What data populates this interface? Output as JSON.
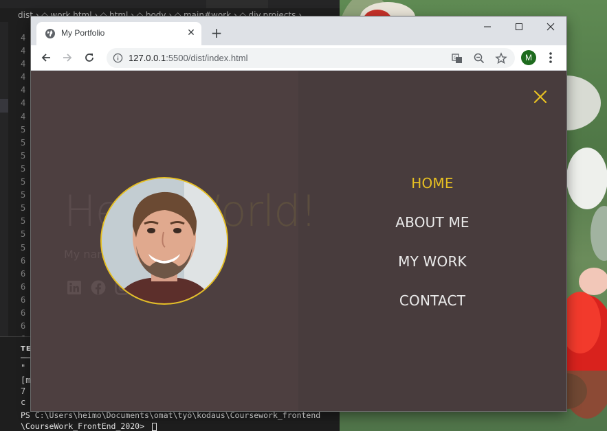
{
  "vscode": {
    "breadcrumb": "dist ›  ◇ work.html ›  ◇ html ›  ◇ body ›  ◇ main#work ›  ◇ div.projects ›",
    "line_numbers": [
      "4",
      "4",
      "4",
      "4",
      "4",
      "4",
      "4",
      "5",
      "5",
      "5",
      "5",
      "5",
      "5",
      "5",
      "5",
      "5",
      "5",
      "6",
      "6",
      "6",
      "6",
      "6",
      "6",
      "6"
    ],
    "panel_tab": "TER",
    "panel_lines": [
      "\"",
      "[m",
      " 7",
      " c"
    ],
    "terminal_line1": "PS C:\\Users\\heimo\\Documents\\omat\\työ\\kodaus\\Coursework_frontend",
    "terminal_line2": "\\CourseWork_FrontEnd_2020> "
  },
  "browser": {
    "tab_title": "My Portfolio",
    "tab_close": "✕",
    "new_tab": "+",
    "url_host": "127.0.0.1",
    "url_rest": ":5500/dist/index.html",
    "profile_initial": "M"
  },
  "page": {
    "hero_title_start": "Hello ",
    "hero_title_accent": "World!",
    "hero_subtitle": "My name is Mike",
    "nav": [
      {
        "label": "HOME",
        "active": true
      },
      {
        "label": "ABOUT ME",
        "active": false
      },
      {
        "label": "MY WORK",
        "active": false
      },
      {
        "label": "CONTACT",
        "active": false
      }
    ],
    "social_icons": [
      "linkedin-icon",
      "facebook-icon",
      "instagram-icon",
      "github-icon"
    ],
    "colors": {
      "accent": "#e7c022",
      "overlay_left": "#4d3f40",
      "overlay_right": "#483c3d",
      "nav_text": "#ebebeb"
    }
  }
}
